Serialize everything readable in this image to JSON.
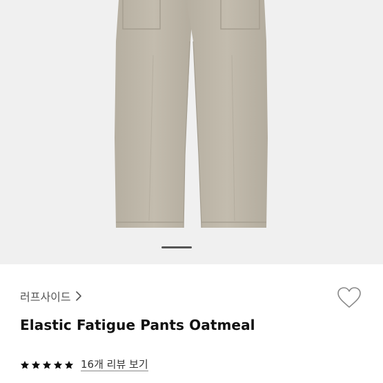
{
  "product": {
    "image_alt": "Elastic Fatigue Pants Oatmeal",
    "carousel": {
      "total": 1,
      "current": 1
    },
    "brand": "러프사이드",
    "title": "Elastic Fatigue Pants Oatmeal",
    "rating": {
      "value": 5,
      "max": 5
    },
    "review_link": "16개 리뷰 보기"
  },
  "icons": {
    "brand_chevron": "chevron-right-icon",
    "wishlist": "heart-outline-icon",
    "star": "star-filled-icon"
  },
  "colors": {
    "hero_bg": "#f0f0f0",
    "pants": "#bdb6a8",
    "star": "#111111",
    "indicator": "#555555"
  }
}
